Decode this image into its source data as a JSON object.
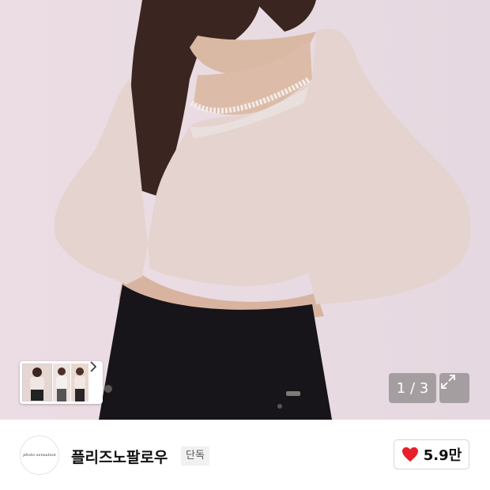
{
  "gallery": {
    "counter_current": "1",
    "counter_separator": "/",
    "counter_total": "3",
    "counter_text": "1 / 3",
    "thumbnail_next_icon": "chevron-right-icon",
    "expand_icon": "expand-icon"
  },
  "store": {
    "logo_text": "photo-sensation",
    "name": "플리즈노팔로우",
    "badge": "단독"
  },
  "like": {
    "icon": "heart-icon",
    "count": "5.9만",
    "color": "#e8202a"
  },
  "colors": {
    "hero_background": "#eadbe2",
    "top_color": "#e7d8d4",
    "skirt_color": "#17141a"
  }
}
